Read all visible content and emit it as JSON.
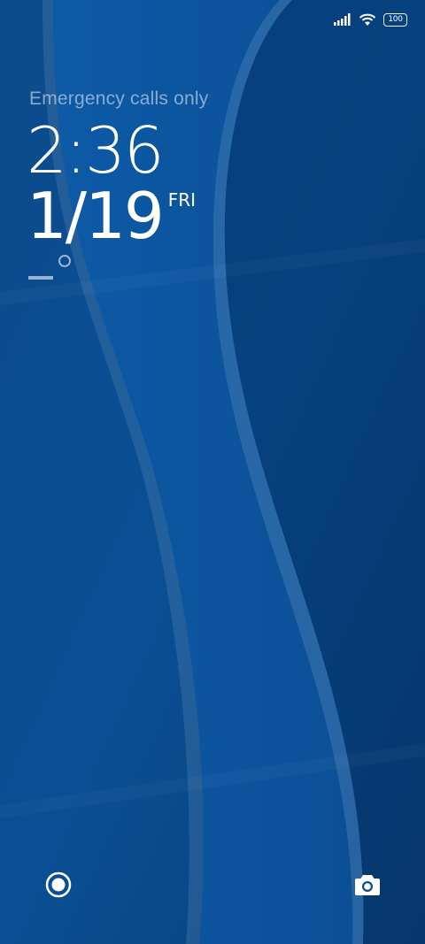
{
  "status_bar": {
    "signal_icon": "signal-bars-icon",
    "wifi_icon": "wifi-icon",
    "battery_level": "100"
  },
  "lockscreen": {
    "carrier_text": "Emergency calls only",
    "time": "2:36",
    "date": "1/19",
    "weekday": "FRI",
    "weather_icon": "weather-degree-icon"
  },
  "shortcuts": {
    "left_icon": "voice-assistant-icon",
    "right_icon": "camera-icon"
  },
  "colors": {
    "background": "#0a4a8a",
    "text": "#ffffff"
  }
}
